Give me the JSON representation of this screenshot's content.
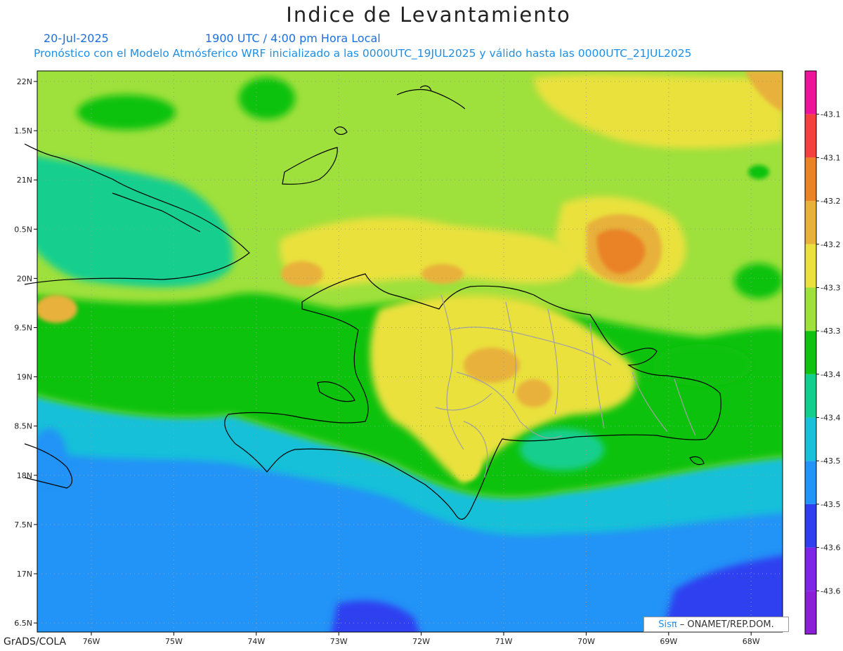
{
  "title": "Indice de Levantamiento",
  "date": "20-Jul-2025",
  "time": "1900 UTC / 4:00 pm Hora Local",
  "description": "Pronóstico con el Modelo Atmósferico WRF inicializado a las 0000UTC_19JUL2025 y válido hasta las  0000UTC_21JUL2025",
  "footer_left": "GrADS/COLA",
  "credit": {
    "logo": "Sisπ",
    "text": "– ONAMET/REP.DOM."
  },
  "lat_labels": [
    "22N",
    "1.5N",
    "21N",
    "0.5N",
    "20N",
    "9.5N",
    "19N",
    "8.5N",
    "18N",
    "7.5N",
    "17N",
    "6.5N"
  ],
  "lon_labels": [
    "76W",
    "75W",
    "74W",
    "73W",
    "72W",
    "71W",
    "70W",
    "69W",
    "68W"
  ],
  "colorbar": {
    "labels": [
      "-43.1",
      "-43.1",
      "-43.2",
      "-43.2",
      "-43.3",
      "-43.3",
      "-43.4",
      "-43.4",
      "-43.5",
      "-43.5",
      "-43.6",
      "-43.6"
    ],
    "colors": [
      "#8a1fd6",
      "#7d24e6",
      "#2f3ff0",
      "#2293f7",
      "#19c0d9",
      "#13cf8e",
      "#10c210",
      "#9ee03c",
      "#eae13c",
      "#e8b13a",
      "#ea8226",
      "#f4413f",
      "#ee1499"
    ]
  }
}
